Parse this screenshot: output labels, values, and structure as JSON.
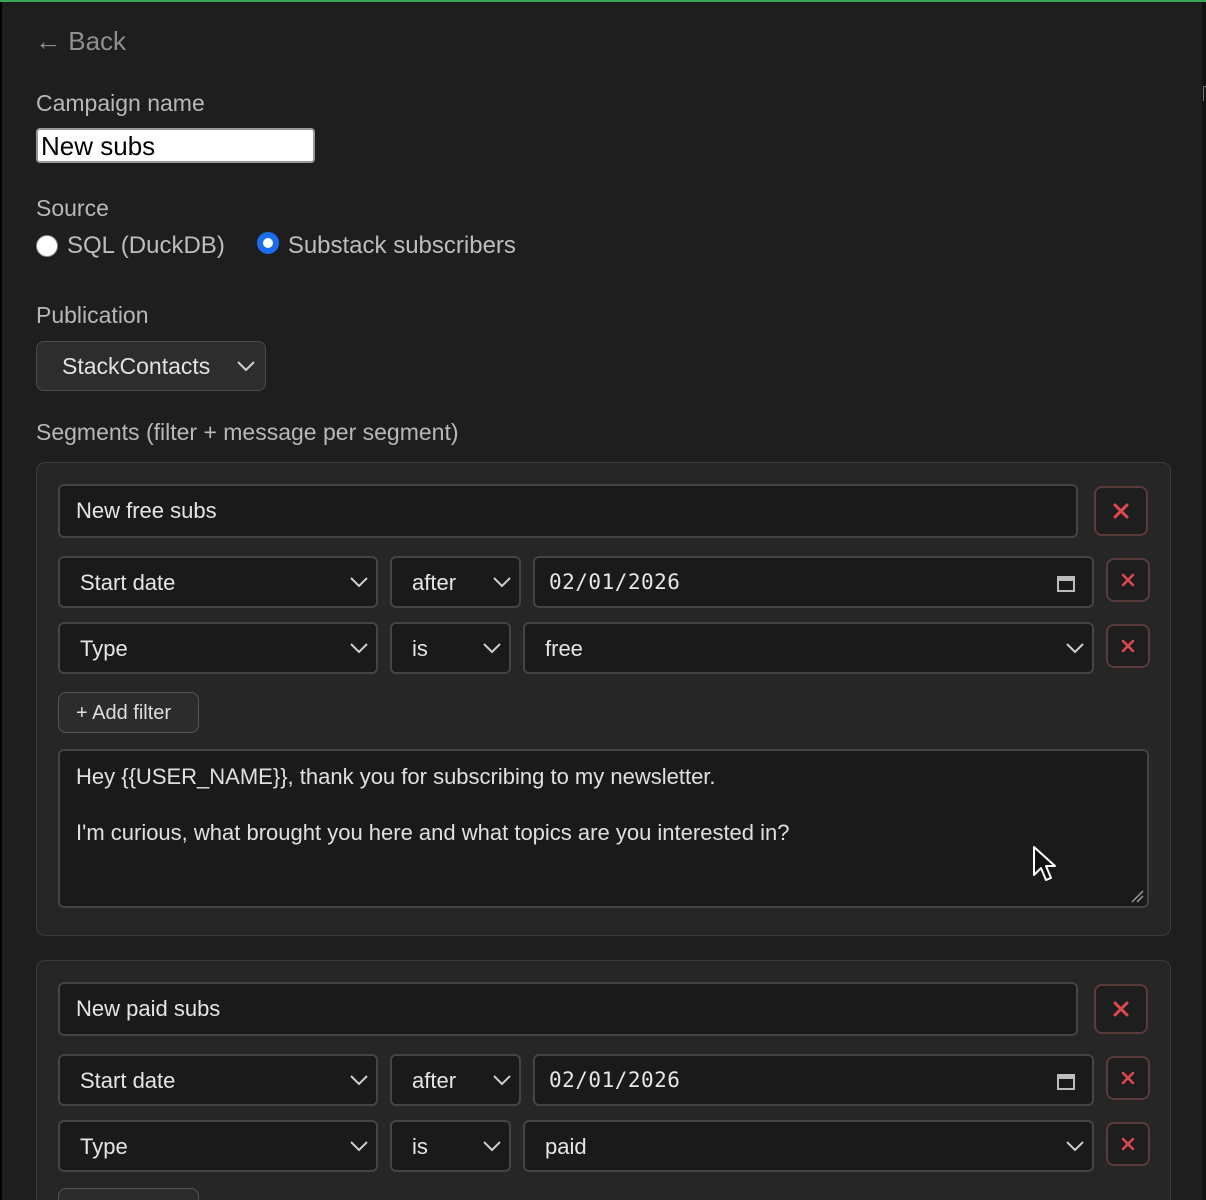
{
  "nav": {
    "back_label": "← Back"
  },
  "campaign": {
    "label": "Campaign name",
    "value": "New subs"
  },
  "source": {
    "label": "Source",
    "options": [
      {
        "label": "SQL (DuckDB)",
        "selected": false
      },
      {
        "label": "Substack subscribers",
        "selected": true
      }
    ]
  },
  "publication": {
    "label": "Publication",
    "selected": "StackContacts"
  },
  "segments": {
    "heading": "Segments (filter + message per segment)",
    "add_filter_label": "+ Add filter",
    "items": [
      {
        "name": "New free subs",
        "filters": [
          {
            "field": "Start date",
            "operator": "after",
            "value": "02/01/2026"
          },
          {
            "field": "Type",
            "operator": "is",
            "value": "free"
          }
        ],
        "message_line1": "Hey {{USER_NAME}},  thank you for subscribing to my newsletter.",
        "message_line2": "I'm curious, what brought you here and what topics are you interested in?"
      },
      {
        "name": "New paid subs",
        "filters": [
          {
            "field": "Start date",
            "operator": "after",
            "value": "02/01/2026"
          },
          {
            "field": "Type",
            "operator": "is",
            "value": "paid"
          }
        ]
      }
    ]
  },
  "colors": {
    "background": "#1e1e1e",
    "radio_selected": "#1a6cf0",
    "remove_icon": "#e0484f"
  }
}
